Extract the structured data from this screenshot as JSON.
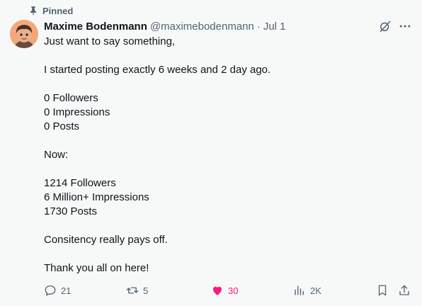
{
  "pinned_label": "Pinned",
  "author": {
    "name": "Maxime Bodenmann",
    "handle": "@maximebodenmann",
    "separator": "·",
    "date": "Jul 1"
  },
  "post_lines": [
    "Just want to say something,",
    "",
    "I started posting exactly 6 weeks and 2 day ago.",
    "",
    "0 Followers",
    "0 Impressions",
    "0 Posts",
    "",
    "Now:",
    "",
    "1214 Followers",
    "6 Million+ Impressions",
    "1730 Posts",
    "",
    "Consitency really pays off.",
    "",
    "Thank you all on here!"
  ],
  "stats": {
    "replies": "21",
    "reposts": "5",
    "likes": "30",
    "views": "2K"
  },
  "colors": {
    "like": "#f91880",
    "muted": "#536471",
    "text": "#0f1419",
    "background": "#f7f9f9"
  },
  "icons": [
    "pin-icon",
    "grok-icon",
    "more-icon",
    "reply-icon",
    "repost-icon",
    "heart-icon",
    "views-icon",
    "bookmark-icon",
    "share-icon"
  ]
}
